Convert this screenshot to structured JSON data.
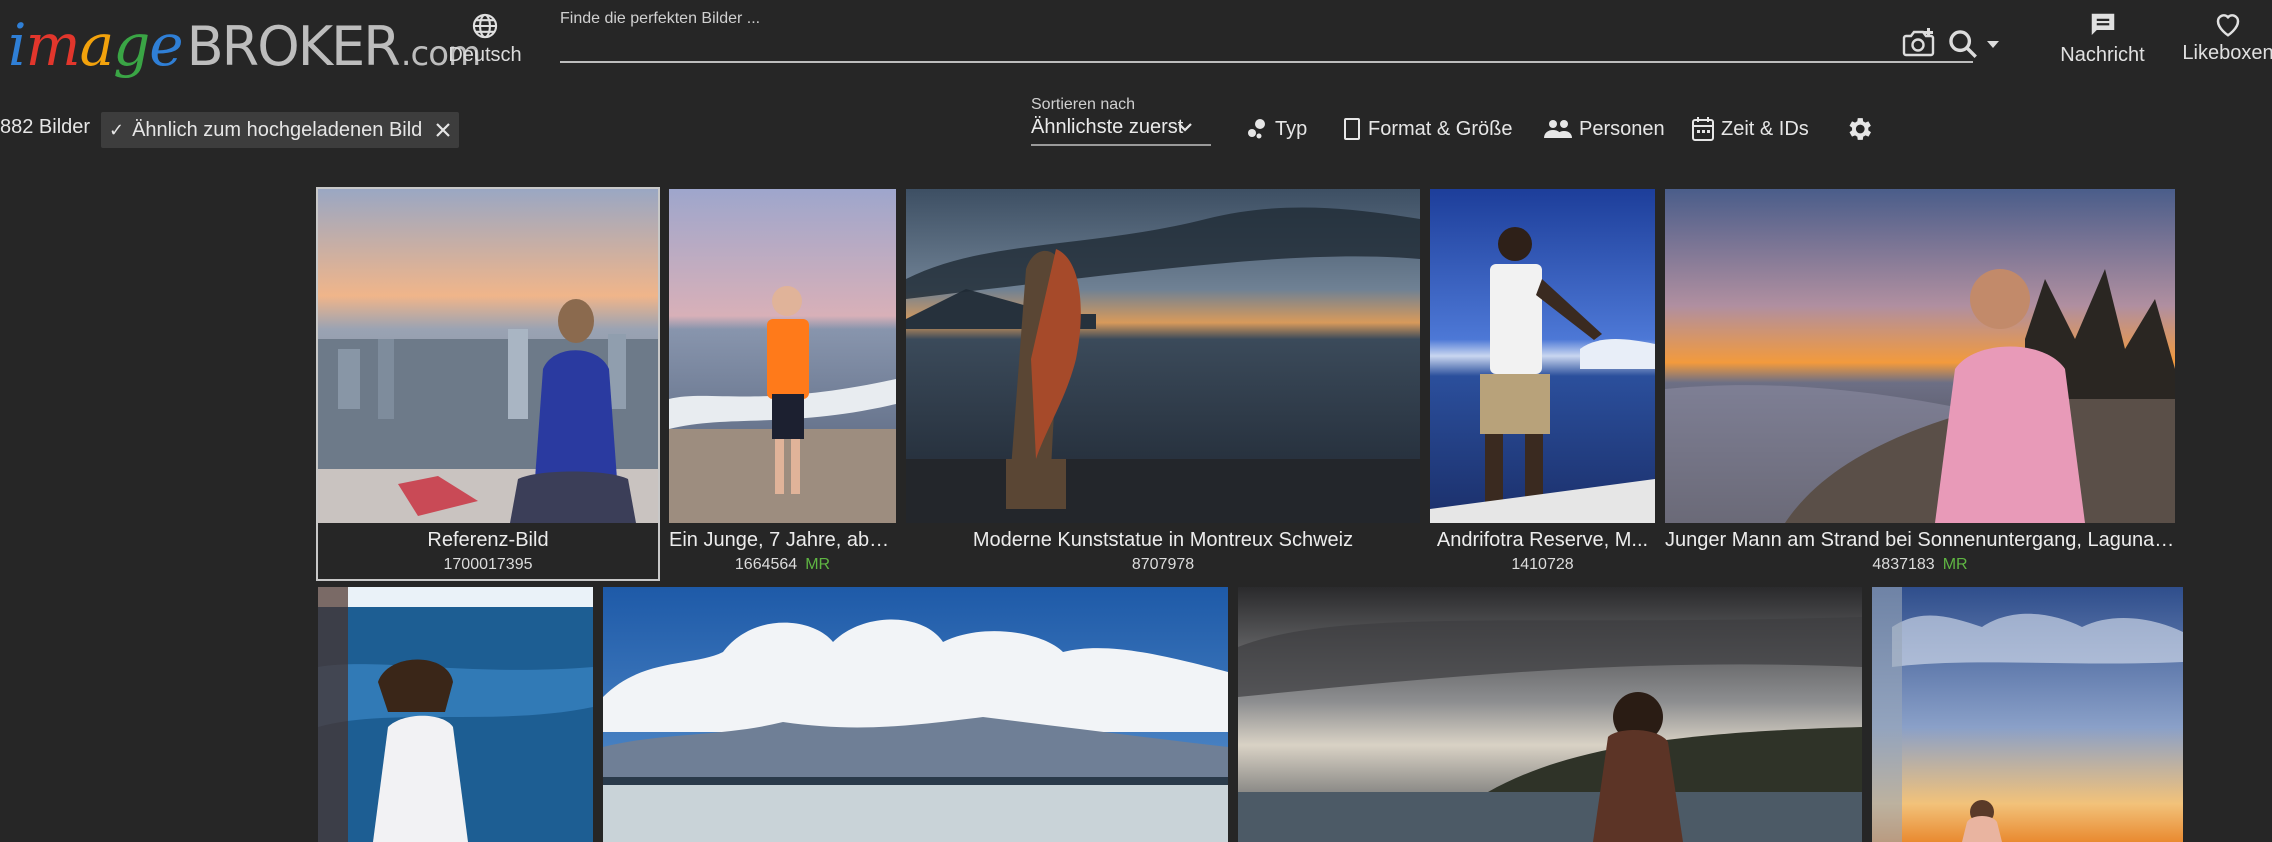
{
  "header": {
    "logo": {
      "i": "i",
      "m": "m",
      "a": "a",
      "g": "g",
      "e": "e",
      "broker": "BROKER",
      "com": ".com"
    },
    "language_label": "Deutsch",
    "search": {
      "label": "Finde die perfekten Bilder ...",
      "value": "",
      "placeholder": ""
    },
    "message_label": "Nachricht",
    "likebox_label": "Likeboxen"
  },
  "toolbar": {
    "result_count": "882 Bilder",
    "active_filter": "Ähnlich zum hochgeladenen Bild",
    "sort_label": "Sortieren nach",
    "sort_value": "Ähnlichste zuerst",
    "filters": {
      "type": "Typ",
      "format": "Format & Größe",
      "persons": "Personen",
      "time": "Zeit & IDs"
    }
  },
  "results": [
    {
      "title": "Referenz-Bild",
      "id": "1700017395",
      "badge": ""
    },
    {
      "title": "Ein Junge, 7 Jahre, abe...",
      "id": "1664564",
      "badge": "MR"
    },
    {
      "title": "Moderne Kunststatue in Montreux Schweiz",
      "id": "8707978",
      "badge": ""
    },
    {
      "title": "Andrifotra Reserve, M...",
      "id": "1410728",
      "badge": ""
    },
    {
      "title": "Junger Mann am Strand bei Sonnenuntergang, Laguna ...",
      "id": "4837183",
      "badge": "MR"
    },
    {
      "title": "",
      "id": "",
      "badge": ""
    },
    {
      "title": "",
      "id": "",
      "badge": ""
    },
    {
      "title": "",
      "id": "",
      "badge": ""
    },
    {
      "title": "",
      "id": "",
      "badge": ""
    }
  ],
  "colors": {
    "background": "#262626",
    "accent_green": "#5fb543",
    "chip": "#3d3d3d"
  }
}
